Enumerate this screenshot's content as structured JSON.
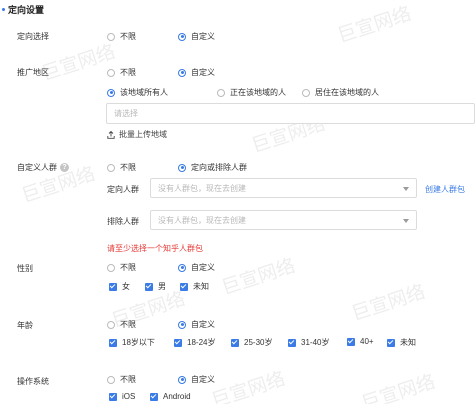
{
  "section_title": "定向设置",
  "targeting_mode": {
    "label": "定向选择",
    "opt_unlimited": "不限",
    "opt_custom": "自定义"
  },
  "region": {
    "label": "推广地区",
    "opt_unlimited": "不限",
    "opt_custom": "自定义",
    "scope_all": "该地域所有人",
    "scope_present": "正在该地域的人",
    "scope_resident": "居住在该地域的人",
    "placeholder": "请选择",
    "upload_label": "批量上传地域"
  },
  "audience": {
    "label": "自定义人群",
    "help_icon_text": "?",
    "opt_unlimited": "不限",
    "opt_custom": "定向或排除人群",
    "include_label": "定向人群",
    "include_placeholder": "没有人群包，现在去创建",
    "create_link": "创建人群包",
    "exclude_label": "排除人群",
    "exclude_placeholder": "没有人群包，现在去创建",
    "error": "请至少选择一个知乎人群包"
  },
  "gender": {
    "label": "性别",
    "opt_unlimited": "不限",
    "opt_custom": "自定义",
    "options": [
      "女",
      "男",
      "未知"
    ]
  },
  "age": {
    "label": "年龄",
    "opt_unlimited": "不限",
    "opt_custom": "自定义",
    "options": [
      "18岁以下",
      "18-24岁",
      "25-30岁",
      "31-40岁",
      "40+",
      "未知"
    ]
  },
  "os": {
    "label": "操作系统",
    "opt_unlimited": "不限",
    "opt_custom": "自定义",
    "options": [
      "iOS",
      "Android"
    ]
  },
  "watermark": "巨宣网络",
  "colors": {
    "accent": "#3a7be6",
    "error": "#e53935",
    "border": "#dcdcdc"
  }
}
